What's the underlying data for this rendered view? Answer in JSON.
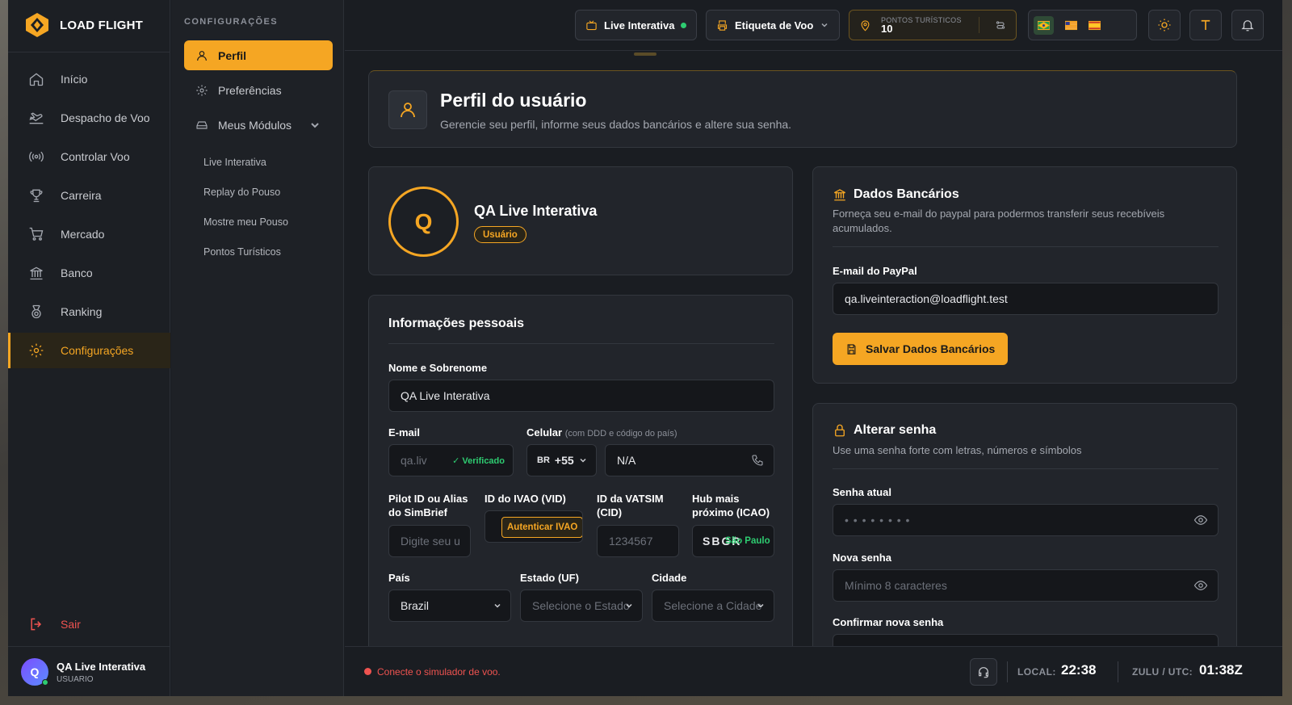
{
  "app": {
    "name": "LOAD FLIGHT"
  },
  "sidebar": {
    "items": [
      {
        "label": "Início"
      },
      {
        "label": "Despacho de Voo"
      },
      {
        "label": "Controlar Voo"
      },
      {
        "label": "Carreira"
      },
      {
        "label": "Mercado"
      },
      {
        "label": "Banco"
      },
      {
        "label": "Ranking"
      },
      {
        "label": "Configurações"
      }
    ],
    "logout": "Sair",
    "user": {
      "initial": "Q",
      "name": "QA Live Interativa",
      "role": "USUARIO"
    }
  },
  "submenu": {
    "title": "CONFIGURAÇÕES",
    "items": [
      {
        "label": "Perfil"
      },
      {
        "label": "Preferências"
      },
      {
        "label": "Meus Módulos"
      }
    ],
    "modules": [
      {
        "label": "Live Interativa"
      },
      {
        "label": "Replay do Pouso"
      },
      {
        "label": "Mostre meu Pouso"
      },
      {
        "label": "Pontos Turísticos"
      }
    ]
  },
  "topbar": {
    "live": "Live Interativa",
    "etiqueta": "Etiqueta de Voo",
    "points_label": "PONTOS TURÍSTICOS",
    "points_value": "10"
  },
  "header": {
    "title": "Perfil do usuário",
    "subtitle": "Gerencie seu perfil, informe seus dados bancários e altere sua senha."
  },
  "profile": {
    "initial": "Q",
    "name": "QA Live Interativa",
    "role": "Usuário"
  },
  "personal": {
    "title": "Informações pessoais",
    "name_label": "Nome e Sobrenome",
    "name_value": "QA Live Interativa",
    "email_label": "E-mail",
    "email_value": "qa.liv",
    "verified": "✓ Verificado",
    "phone_label": "Celular",
    "phone_hint": "(com DDD e código do país)",
    "country_code": "BR",
    "dial_code": "+55",
    "phone_value": "N/A",
    "pilot_label": "Pilot ID ou Alias do SimBrief",
    "pilot_placeholder": "Digite seu u",
    "ivao_label": "ID do IVAO (VID)",
    "ivao_button": "Autenticar IVAO",
    "vatsim_label": "ID da VATSIM (CID)",
    "vatsim_placeholder": "1234567",
    "hub_label": "Hub mais próximo (ICAO)",
    "hub_value": "SBGR",
    "hub_city": "São Paulo",
    "country_label": "País",
    "country_value": "Brazil",
    "state_label": "Estado (UF)",
    "state_placeholder": "Selecione o Estado",
    "city_label": "Cidade",
    "city_placeholder": "Selecione a Cidade"
  },
  "bank": {
    "title": "Dados Bancários",
    "desc": "Forneça seu e-mail do paypal para podermos transferir seus recebíveis acumulados.",
    "email_label": "E-mail do PayPal",
    "email_value": "qa.liveinteraction@loadflight.test",
    "save": "Salvar Dados Bancários"
  },
  "password": {
    "title": "Alterar senha",
    "desc": "Use uma senha forte com letras, números e símbolos",
    "current_label": "Senha atual",
    "current_value": "• • • • • • • •",
    "new_label": "Nova senha",
    "new_placeholder": "Mínimo 8 caracteres",
    "confirm_label": "Confirmar nova senha"
  },
  "status": {
    "message": "Conecte o simulador de voo.",
    "local_label": "LOCAL:",
    "local_time": "22:38",
    "utc_label": "ZULU / UTC:",
    "utc_time": "01:38Z"
  },
  "colors": {
    "accent": "#f5a623",
    "success": "#2ecc71",
    "danger": "#ef5350"
  }
}
